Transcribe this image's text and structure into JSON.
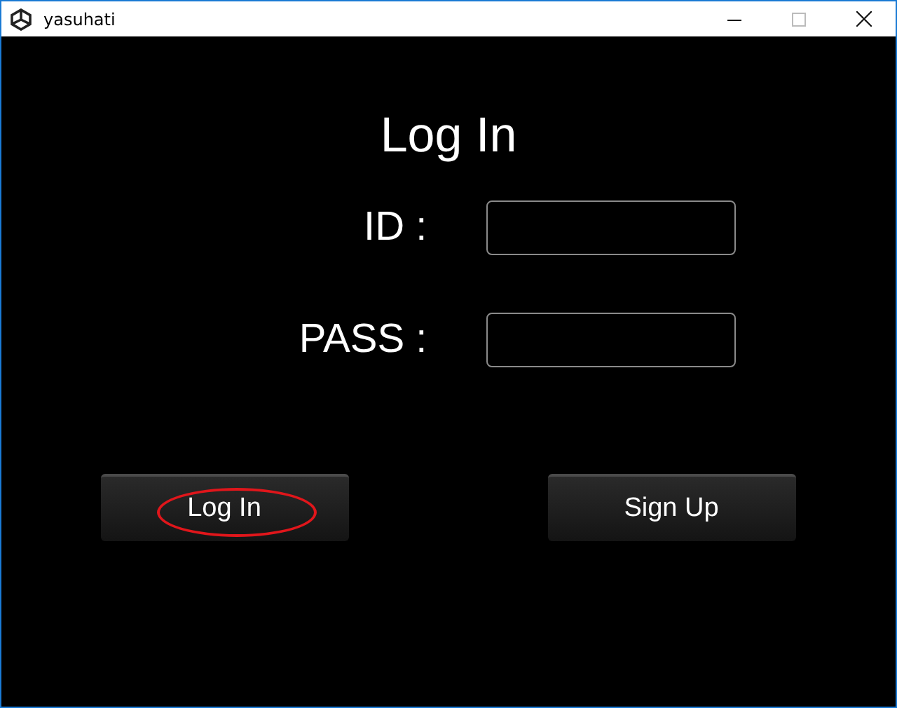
{
  "window": {
    "title": "yasuhati"
  },
  "heading": "Log In",
  "fields": [
    {
      "label": "ID :"
    },
    {
      "label": "PASS :"
    }
  ],
  "buttons": [
    {
      "label": "Log In",
      "circled": true
    },
    {
      "label": "Sign Up",
      "circled": false
    }
  ]
}
